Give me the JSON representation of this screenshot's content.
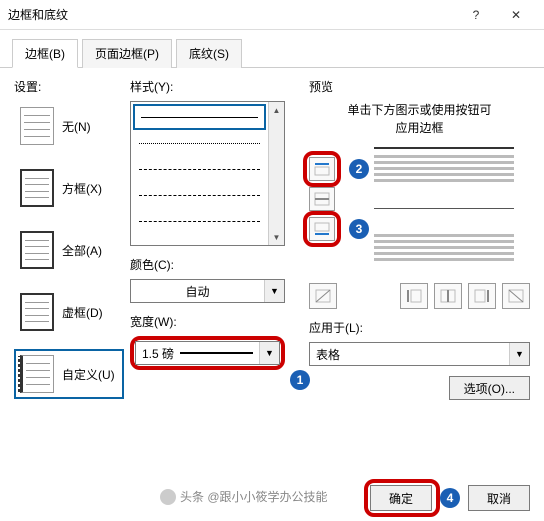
{
  "title": "边框和底纹",
  "tabs": {
    "border": "边框(B)",
    "page": "页面边框(P)",
    "shading": "底纹(S)"
  },
  "settings": {
    "label": "设置:",
    "none": "无(N)",
    "box": "方框(X)",
    "all": "全部(A)",
    "dashed": "虚框(D)",
    "custom": "自定义(U)"
  },
  "style": {
    "label": "样式(Y):"
  },
  "color": {
    "label": "颜色(C):",
    "value": "自动"
  },
  "width": {
    "label": "宽度(W):",
    "value": "1.5 磅"
  },
  "preview": {
    "label": "预览",
    "hint1": "单击下方图示或使用按钮可",
    "hint2": "应用边框"
  },
  "apply": {
    "label": "应用于(L):",
    "value": "表格"
  },
  "options": "选项(O)...",
  "ok": "确定",
  "cancel": "取消",
  "attrib": "头条 @跟小小筱学办公技能",
  "nums": {
    "n1": "1",
    "n2": "2",
    "n3": "3",
    "n4": "4"
  }
}
